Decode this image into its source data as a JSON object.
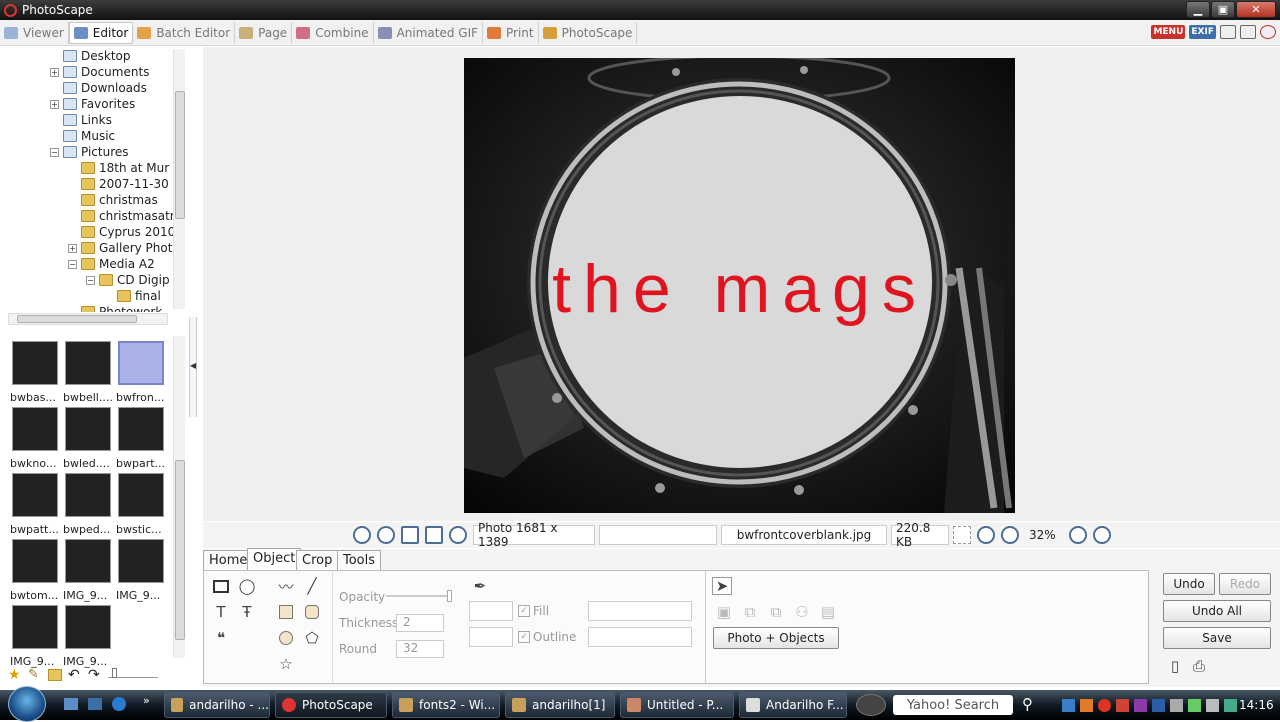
{
  "window": {
    "title": "PhotoScape"
  },
  "menu": {
    "tabs": [
      {
        "label": "Viewer",
        "active": false
      },
      {
        "label": "Editor",
        "active": true
      },
      {
        "label": "Batch Editor",
        "active": false
      },
      {
        "label": "Page",
        "active": false
      },
      {
        "label": "Combine",
        "active": false
      },
      {
        "label": "Animated GIF",
        "active": false
      },
      {
        "label": "Print",
        "active": false
      },
      {
        "label": "PhotoScape",
        "active": false
      }
    ],
    "right_badges": [
      "MENU",
      "EXIF"
    ]
  },
  "tree": {
    "nodes": [
      {
        "label": "Desktop",
        "expand": ""
      },
      {
        "label": "Documents",
        "expand": "+"
      },
      {
        "label": "Downloads",
        "expand": ""
      },
      {
        "label": "Favorites",
        "expand": "+"
      },
      {
        "label": "Links",
        "expand": ""
      },
      {
        "label": "Music",
        "expand": ""
      },
      {
        "label": "Pictures",
        "expand": "−"
      },
      {
        "label": "18th at Mur",
        "expand": ""
      },
      {
        "label": "2007-11-30",
        "expand": ""
      },
      {
        "label": "christmas",
        "expand": ""
      },
      {
        "label": "christmasatr",
        "expand": ""
      },
      {
        "label": "Cyprus 2010",
        "expand": ""
      },
      {
        "label": "Gallery Phot",
        "expand": "+"
      },
      {
        "label": "Media A2",
        "expand": "−"
      },
      {
        "label": "CD Digip",
        "expand": "−"
      },
      {
        "label": "final",
        "expand": ""
      },
      {
        "label": "Photowork",
        "expand": ""
      }
    ]
  },
  "thumbnails": [
    {
      "label": "bwbas..."
    },
    {
      "label": "bwbell...."
    },
    {
      "label": "bwfron...",
      "selected": true
    },
    {
      "label": "bwkno..."
    },
    {
      "label": "bwled...."
    },
    {
      "label": "bwpart..."
    },
    {
      "label": "bwpatt..."
    },
    {
      "label": "bwped..."
    },
    {
      "label": "bwstic..."
    },
    {
      "label": "bwtom..."
    },
    {
      "label": "IMG_9..."
    },
    {
      "label": "IMG_9..."
    },
    {
      "label": "IMG_9..."
    },
    {
      "label": "IMG_9..."
    }
  ],
  "canvas": {
    "photo_text": "the mags",
    "text_color": "#e0141e"
  },
  "status": {
    "dimensions": "Photo 1681 x 1389",
    "filename": "bwfrontcoverblank.jpg",
    "filesize": "220.8 KB",
    "zoom": "32%"
  },
  "edit": {
    "tabs": [
      "Home",
      "Object",
      "Crop",
      "Tools"
    ],
    "active_tab": "Object",
    "opacity_label": "Opacity",
    "fill_label": "Fill",
    "thickness_label": "Thickness",
    "thickness_value": "2",
    "outline_label": "Outline",
    "round_label": "Round",
    "round_value": "32",
    "photo_objects_button": "Photo + Objects"
  },
  "actions": {
    "undo": "Undo",
    "redo": "Redo",
    "undo_all": "Undo All",
    "save": "Save"
  },
  "taskbar": {
    "tasks": [
      {
        "label": "andarilho - ..."
      },
      {
        "label": "PhotoScape",
        "active": true
      },
      {
        "label": "fonts2 - Wi..."
      },
      {
        "label": "andarilho[1]"
      },
      {
        "label": "Untitled - P..."
      },
      {
        "label": "Andarilho F..."
      }
    ],
    "search_placeholder": "Yahoo! Search",
    "clock": "14:16"
  }
}
